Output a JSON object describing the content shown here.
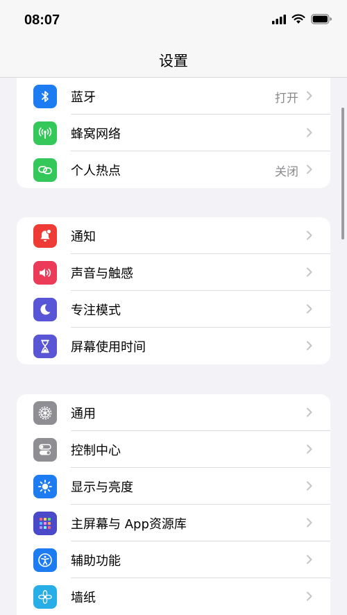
{
  "status": {
    "time": "08:07"
  },
  "nav": {
    "title": "设置"
  },
  "colors": {
    "bluetooth": "#1e7cf2",
    "cellular": "#34c759",
    "hotspot": "#34c759",
    "notifications": "#ee3b35",
    "sounds": "#eb3b58",
    "focus": "#5855d6",
    "screen_time": "#5955d4",
    "general": "#8e8e93",
    "control_center": "#8e8e93",
    "display": "#1e7cf2",
    "home_screen": "#4a49c9",
    "accessibility": "#1e7cf2",
    "wallpaper": "#27aee6"
  },
  "groups": [
    {
      "items": [
        {
          "label": "蓝牙",
          "value": "打开",
          "icon": "bluetooth-icon"
        },
        {
          "label": "蜂窝网络",
          "value": "",
          "icon": "cellular-antenna-icon"
        },
        {
          "label": "个人热点",
          "value": "关闭",
          "icon": "hotspot-link-icon"
        }
      ]
    },
    {
      "items": [
        {
          "label": "通知",
          "value": "",
          "icon": "notification-bell-icon"
        },
        {
          "label": "声音与触感",
          "value": "",
          "icon": "speaker-icon"
        },
        {
          "label": "专注模式",
          "value": "",
          "icon": "moon-icon"
        },
        {
          "label": "屏幕使用时间",
          "value": "",
          "icon": "hourglass-icon"
        }
      ]
    },
    {
      "items": [
        {
          "label": "通用",
          "value": "",
          "icon": "gear-icon"
        },
        {
          "label": "控制中心",
          "value": "",
          "icon": "toggles-icon"
        },
        {
          "label": "显示与亮度",
          "value": "",
          "icon": "sun-icon"
        },
        {
          "label": "主屏幕与 App资源库",
          "value": "",
          "icon": "app-grid-icon"
        },
        {
          "label": "辅助功能",
          "value": "",
          "icon": "accessibility-icon"
        },
        {
          "label": "墙纸",
          "value": "",
          "icon": "flower-icon"
        }
      ]
    }
  ]
}
